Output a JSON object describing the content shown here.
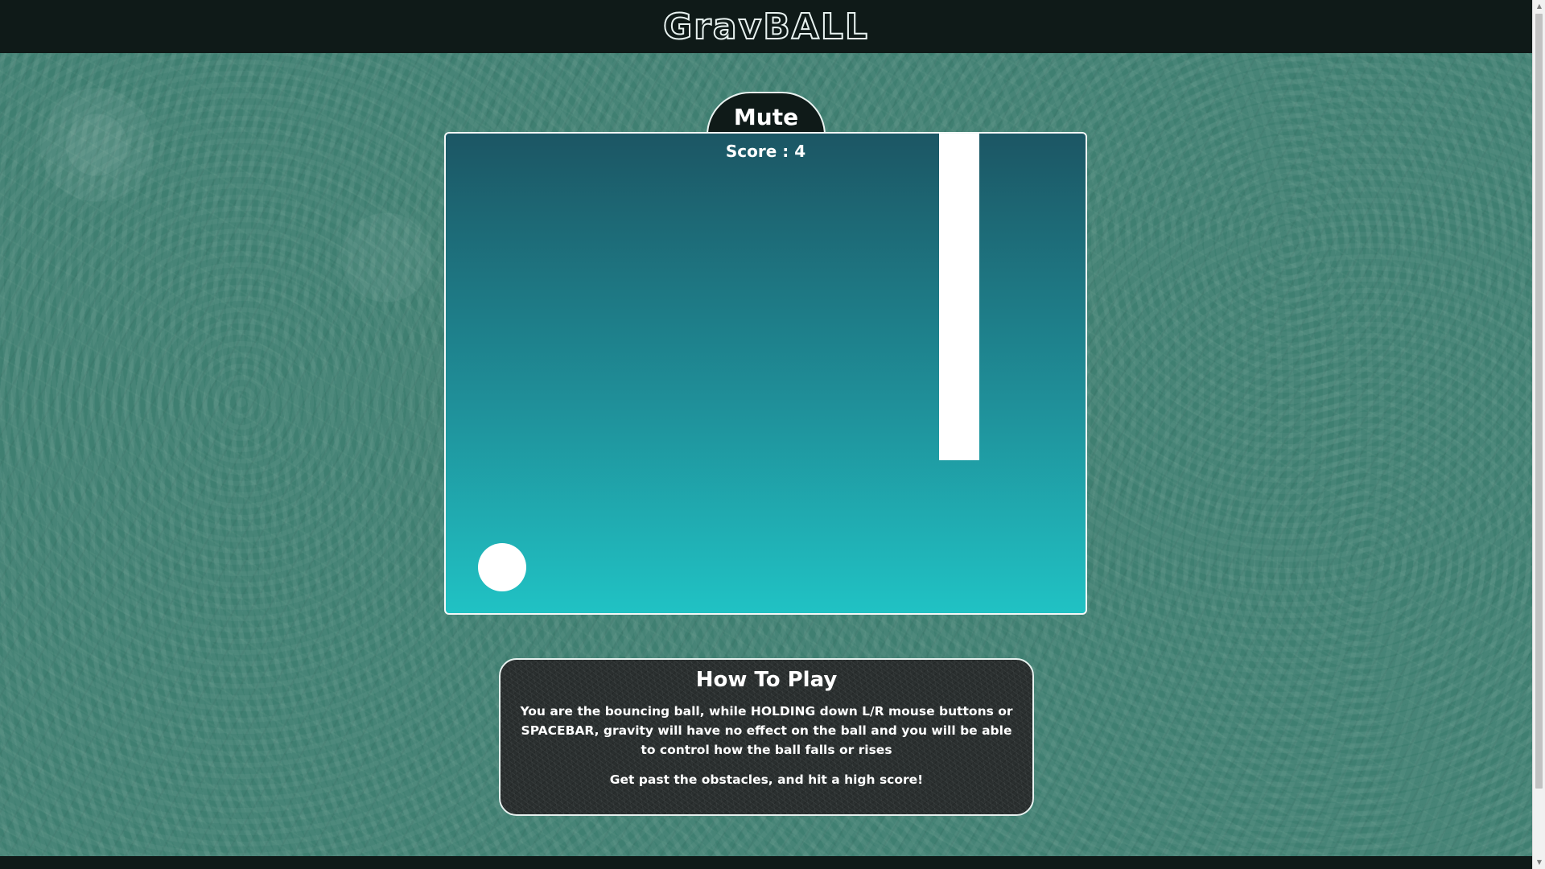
{
  "header": {
    "logo_text": "GravBALL"
  },
  "controls": {
    "mute_label": "Mute"
  },
  "game": {
    "score_label": "Score : 4",
    "score": 4
  },
  "how_to_play": {
    "title": "How To Play",
    "description": "You are the bouncing ball, while HOLDING down L/R mouse buttons or SPACEBAR, gravity will have no effect on the ball and you will be able to control how the ball falls or rises",
    "goal": "Get past the obstacles, and hit a high score!"
  },
  "colors": {
    "page_background": "#3f7f71",
    "bar_background": "#0f1a18",
    "canvas_gradient_top": "#1c5664",
    "canvas_gradient_bottom": "#20c2c4",
    "ball": "#ffffff",
    "obstacle": "#ffffff"
  },
  "icons": {
    "scroll_up": "scroll-up-arrow-icon",
    "scroll_down": "scroll-down-arrow-icon"
  }
}
